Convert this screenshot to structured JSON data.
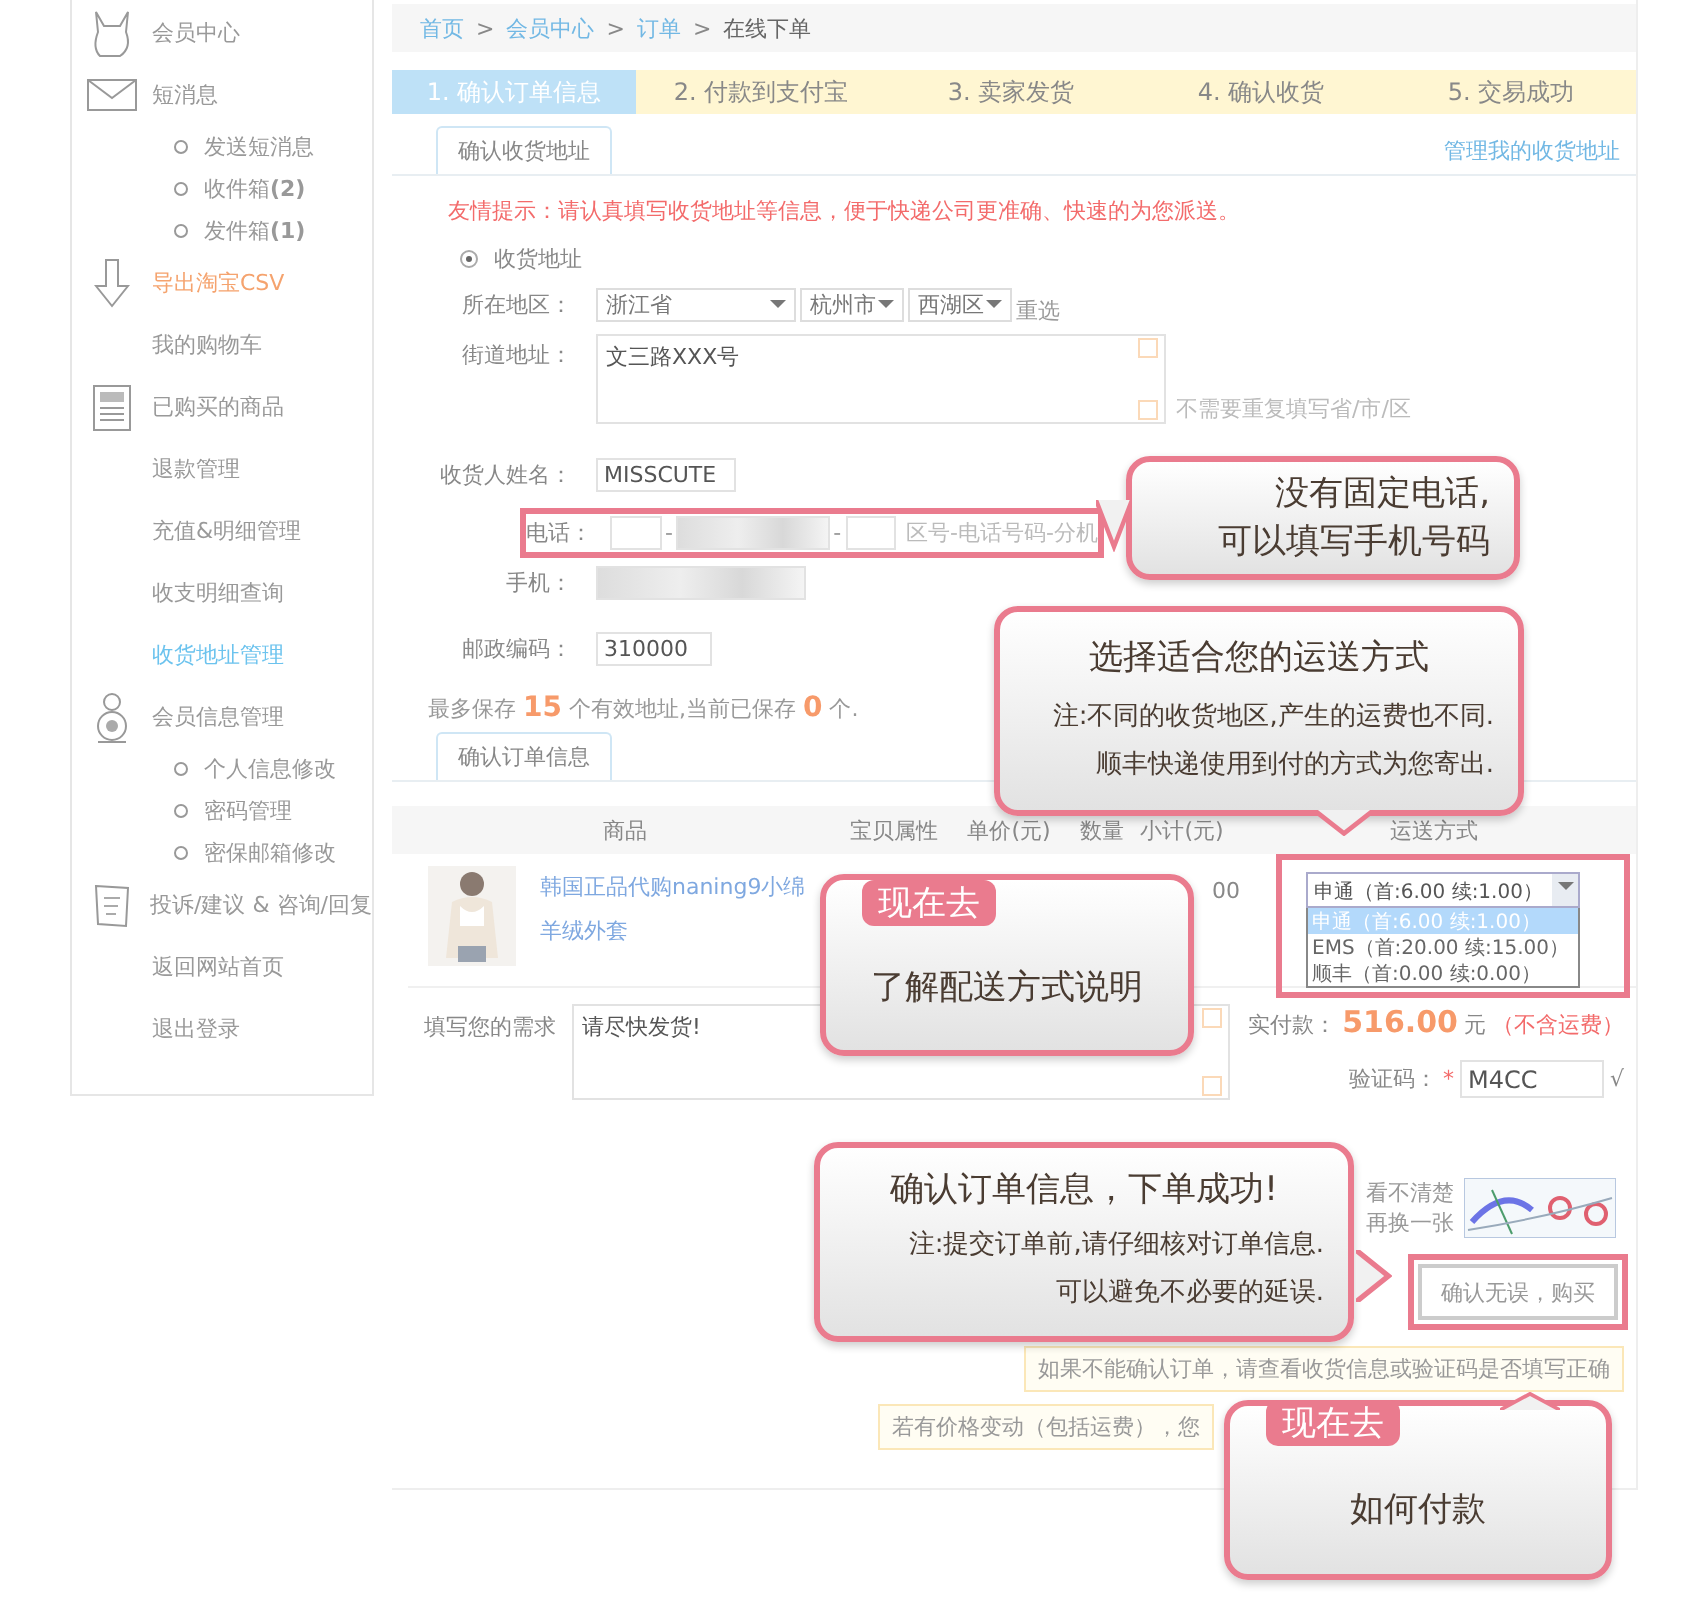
{
  "sidebar": {
    "items": [
      {
        "label": "会员中心",
        "color": "#999999"
      },
      {
        "label": "短消息",
        "color": "#999999",
        "children": [
          {
            "label": "发送短消息"
          },
          {
            "label": "收件箱**(2)**"
          },
          {
            "label": "发件箱**(1)**"
          }
        ]
      },
      {
        "label": "导出淘宝CSV",
        "color": "#f5a36e"
      },
      {
        "label": "我的购物车",
        "color": "#999999"
      },
      {
        "label": "已购买的商品",
        "color": "#999999"
      },
      {
        "label": "退款管理",
        "color": "#999999"
      },
      {
        "label": "充值&明细管理",
        "color": "#999999"
      },
      {
        "label": "收支明细查询",
        "color": "#999999"
      },
      {
        "label": "收货地址管理",
        "color": "#6cc3ee"
      },
      {
        "label": "会员信息管理",
        "color": "#999999",
        "children": [
          {
            "label": "个人信息修改"
          },
          {
            "label": "密码管理"
          },
          {
            "label": "密保邮箱修改"
          }
        ]
      },
      {
        "label": "投诉/建议 & 咨询/回复",
        "color": "#999999"
      },
      {
        "label": "返回网站首页",
        "color": "#999999"
      },
      {
        "label": "退出登录",
        "color": "#999999"
      }
    ]
  },
  "breadcrumb": {
    "separator": ">",
    "items": [
      {
        "label": "首页",
        "link": true
      },
      {
        "label": "会员中心",
        "link": true
      },
      {
        "label": "订单",
        "link": true
      },
      {
        "label": "在线下单",
        "link": false
      }
    ]
  },
  "steps": [
    {
      "label": "1. 确认订单信息",
      "selected": true
    },
    {
      "label": "2. 付款到支付宝",
      "selected": false
    },
    {
      "label": "3. 卖家发货",
      "selected": false
    },
    {
      "label": "4. 确认收货",
      "selected": false
    },
    {
      "label": "5. 交易成功",
      "selected": false
    }
  ],
  "address": {
    "tab": "确认收货地址",
    "manage_link": "管理我的收货地址",
    "tip": "友情提示：请认真填写收货地址等信息，便于快递公司更准确、快速的为您派送。",
    "radio": {
      "label": "收货地址",
      "selected": true
    },
    "region": {
      "label": "所在地区：",
      "province": "浙江省",
      "city": "杭州市",
      "district": "西湖区",
      "reset": "重选"
    },
    "street": {
      "label": "街道地址：",
      "value": "文三路XXX号",
      "hint": "不需要重复填写省/市/区"
    },
    "name": {
      "label": "收货人姓名：",
      "value": "MISSCUTE"
    },
    "phone": {
      "label": "电话：",
      "dash": "-",
      "hint": "区号-电话号码-分机"
    },
    "mobile": {
      "label": "手机："
    },
    "postcode": {
      "label": "邮政编码：",
      "value": "310000"
    },
    "saved_note": {
      "before": "最多保存",
      "max": "15",
      "middle": "个有效地址,当前已保存",
      "count": "0",
      "after": "个."
    }
  },
  "order": {
    "tab": "确认订单信息",
    "columns": [
      "商品",
      "宝贝属性",
      "单价(元)",
      "数量",
      "小计(元)",
      "运送方式"
    ],
    "product": {
      "name": "韩国正品代购naning9小绵羊绒外套",
      "subtotal": "00"
    },
    "shipping": {
      "value": "申通（首:6.00 续:1.00）",
      "options": [
        {
          "label": "申通（首:6.00 续:1.00）",
          "selected": true
        },
        {
          "label": "EMS（首:20.00 续:15.00）",
          "selected": false
        },
        {
          "label": "顺丰（首:0.00 续:0.00）",
          "selected": false
        }
      ]
    },
    "request": {
      "label": "填写您的需求",
      "value": "请尽快发货!"
    },
    "total": {
      "label": "实付款：",
      "amount": "516.00",
      "unit": "元",
      "note": "（不含运费）"
    },
    "captcha": {
      "label": "验证码：",
      "required": "*",
      "value": "M4CC",
      "check": "√",
      "refresh": [
        "看不清楚",
        "再换一张"
      ]
    },
    "submit": "确认无误，购买",
    "notes": [
      "如果不能确认订单，请查看收货信息或验证码是否填写正确",
      "若有价格变动（包括运费），您"
    ]
  },
  "callouts": [
    {
      "lines": [
        "没有固定电话,",
        "可以填写手机号码"
      ]
    },
    {
      "lines": [
        "选择适合您的运送方式"
      ],
      "notes": [
        "注:不同的收货地区,产生的运费也不同.",
        "顺丰快递使用到付的方式为您寄出."
      ]
    },
    {
      "tag": "现在去",
      "lines": [
        "了解配送方式说明"
      ]
    },
    {
      "lines": [
        "确认订单信息，下单成功!"
      ],
      "notes": [
        "注:提交订单前,请仔细核对订单信息.",
        "可以避免不必要的延误."
      ]
    },
    {
      "tag": "现在去",
      "lines": [
        "如何付款"
      ]
    }
  ]
}
